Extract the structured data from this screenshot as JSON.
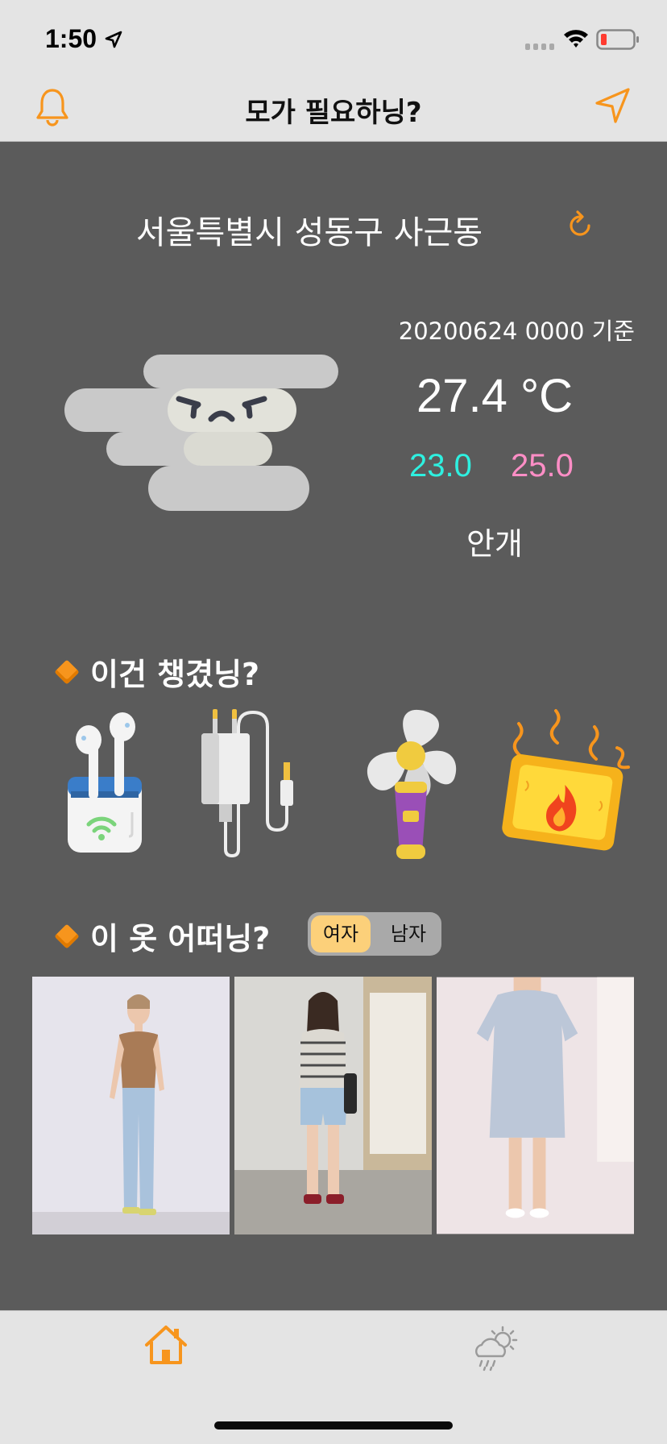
{
  "status_bar": {
    "time": "1:50"
  },
  "nav": {
    "title": "모가 필요하닝?"
  },
  "location": {
    "address": "서울특별시 성동구 사근동"
  },
  "weather": {
    "base_time": "20200624 0000 기준",
    "temperature": "27.4 °C",
    "temp_min": "23.0",
    "temp_max": "25.0",
    "condition": "안개",
    "icon": "angry-fog-cloud-icon"
  },
  "items_section": {
    "title": "이건 챙겼닝?",
    "items": [
      "earbuds-icon",
      "charger-icon",
      "handheld-fan-icon",
      "heat-pack-icon"
    ]
  },
  "outfit_section": {
    "title": "이 옷 어떠닝?",
    "toggle": {
      "female": "여자",
      "male": "남자",
      "selected": "여자"
    },
    "outfits": [
      "outfit-tank-top-jeans",
      "outfit-striped-tee-shorts",
      "outfit-lightblue-dress"
    ]
  },
  "tab_bar": {
    "tabs": [
      "home-icon",
      "weather-icon"
    ],
    "selected": "home-icon"
  },
  "colors": {
    "accent": "#f7951d",
    "min_temp": "#2ef0e0",
    "max_temp": "#ff8ec6",
    "background": "#5b5b5b"
  }
}
